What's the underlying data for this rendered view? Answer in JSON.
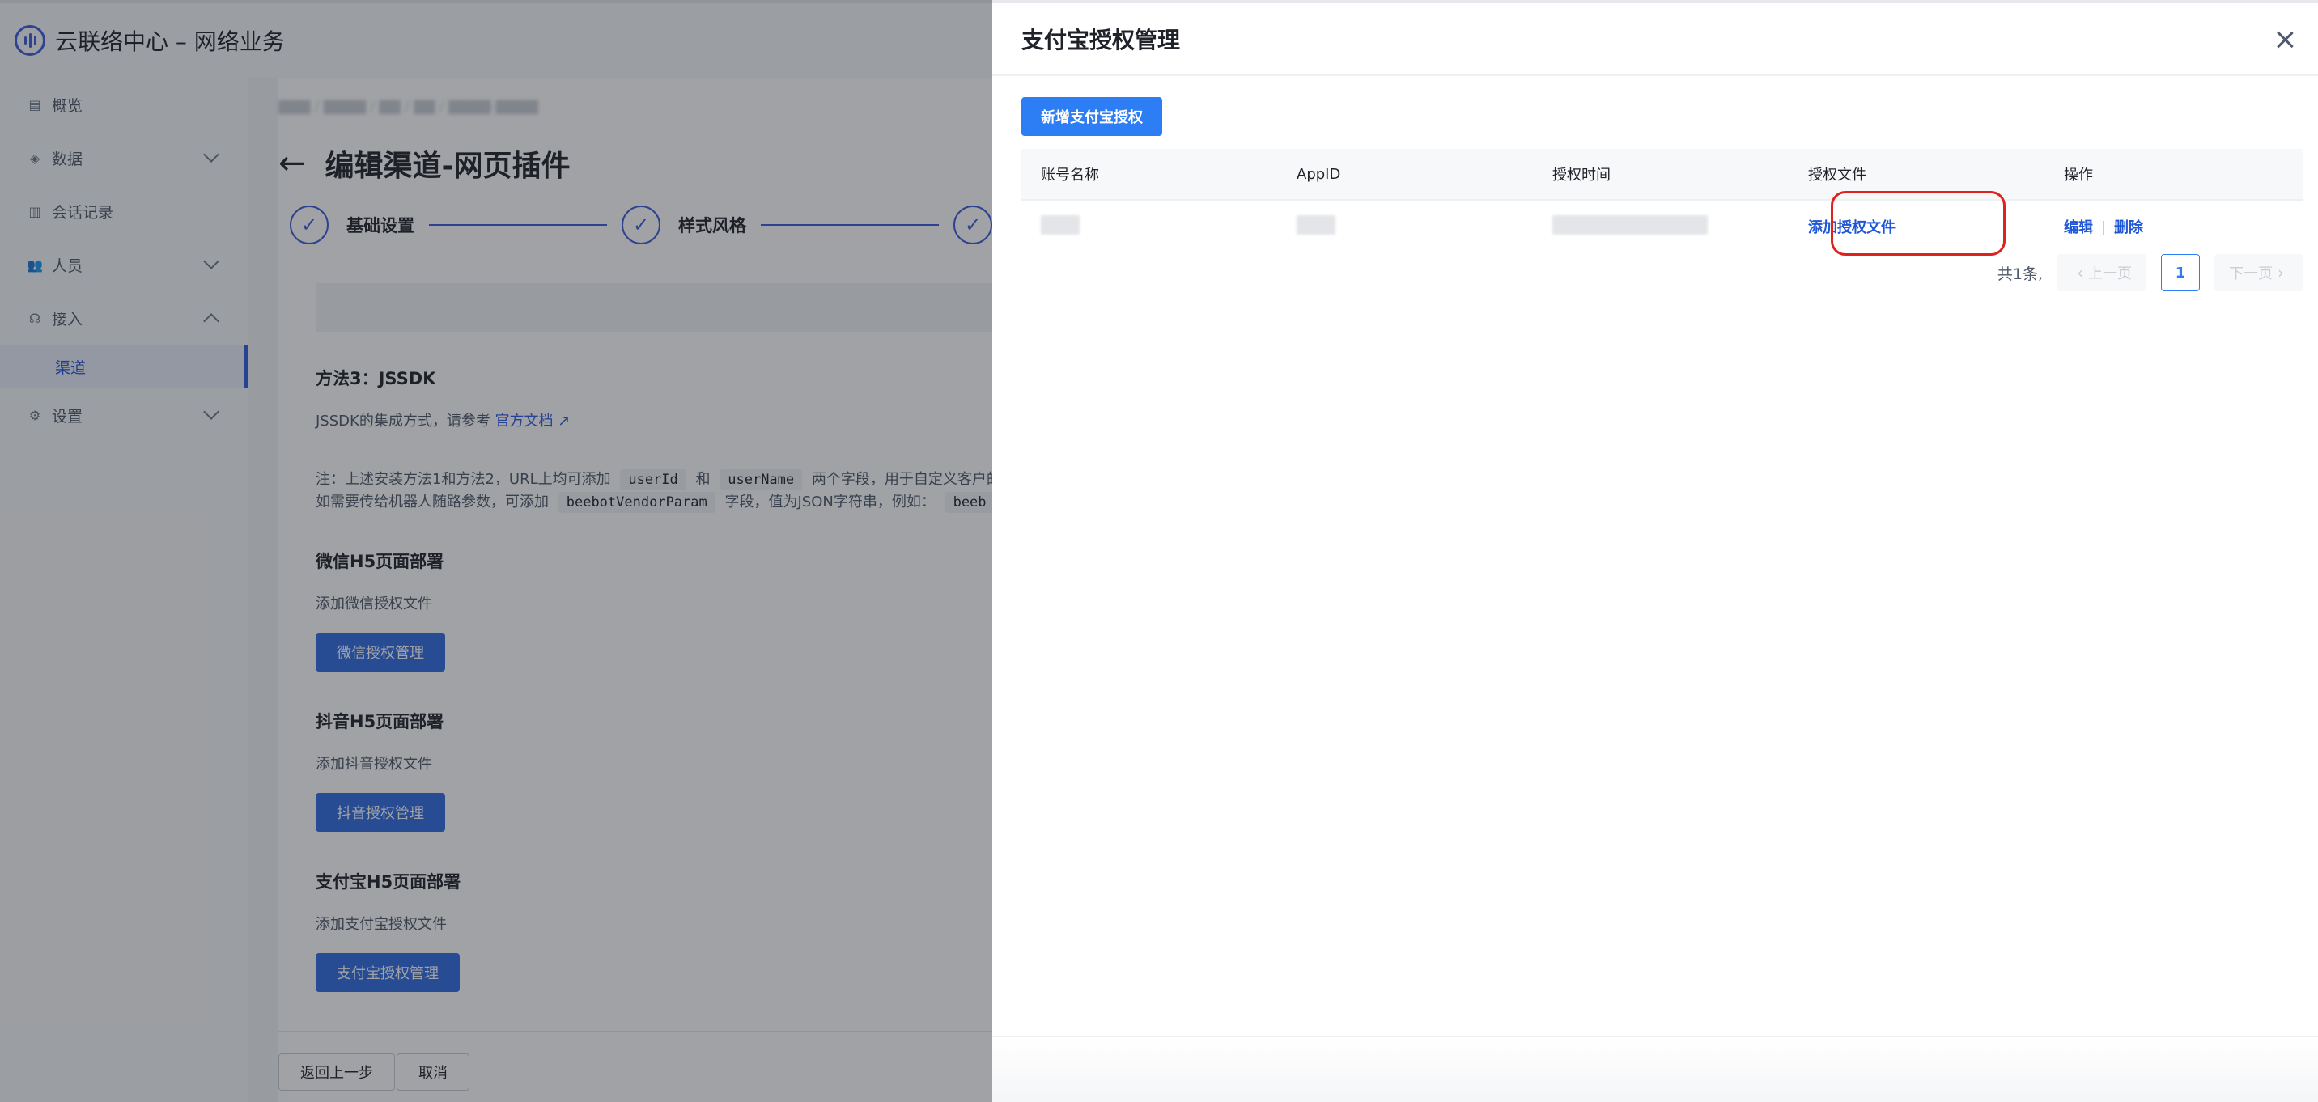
{
  "app": {
    "title": "云联络中心 – 网络业务"
  },
  "sidebar": {
    "items": [
      {
        "label": "概览",
        "icon": "overview-icon"
      },
      {
        "label": "数据",
        "icon": "data-icon"
      },
      {
        "label": "会话记录",
        "icon": "session-icon"
      },
      {
        "label": "人员",
        "icon": "people-icon"
      },
      {
        "label": "接入",
        "icon": "headset-icon"
      },
      {
        "label": "渠道"
      },
      {
        "label": "设置",
        "icon": "gear-icon"
      }
    ]
  },
  "page": {
    "title": "编辑渠道-网页插件",
    "steps": [
      "基础设置",
      "样式风格"
    ],
    "method3_title": "方法3：JSSDK",
    "method3_text": "JSSDK的集成方式，请参考",
    "method3_link": "官方文档",
    "note_prefix": "注：上述安装方法1和方法2，URL上均可添加",
    "note_code1": "userId",
    "note_and": "和",
    "note_code2": "userName",
    "note_suffix": "两个字段，用于自定义客户的",
    "note2_prefix": "如需要传给机器人随路参数，可添加",
    "note2_code": "beebotVendorParam",
    "note2_suffix": "字段，值为JSON字符串，例如：",
    "note2_code2": "beeb",
    "wechat_title": "微信H5页面部署",
    "wechat_text": "添加微信授权文件",
    "wechat_btn": "微信授权管理",
    "douyin_title": "抖音H5页面部署",
    "douyin_text": "添加抖音授权文件",
    "douyin_btn": "抖音授权管理",
    "alipay_title": "支付宝H5页面部署",
    "alipay_text": "添加支付宝授权文件",
    "alipay_btn": "支付宝授权管理",
    "back_btn": "返回上一步",
    "cancel_btn": "取消"
  },
  "drawer": {
    "title": "支付宝授权管理",
    "add_btn": "新增支付宝授权",
    "columns": [
      "账号名称",
      "AppID",
      "授权时间",
      "授权文件",
      "操作"
    ],
    "row": {
      "auth_file_link": "添加授权文件",
      "edit": "编辑",
      "delete": "删除"
    },
    "pager": {
      "total": "共1条,",
      "prev": "上一页",
      "page": "1",
      "next": "下一页"
    }
  },
  "colors": {
    "primary": "#2d7df5",
    "link": "#1f56d6",
    "annotation": "#e0221f"
  }
}
